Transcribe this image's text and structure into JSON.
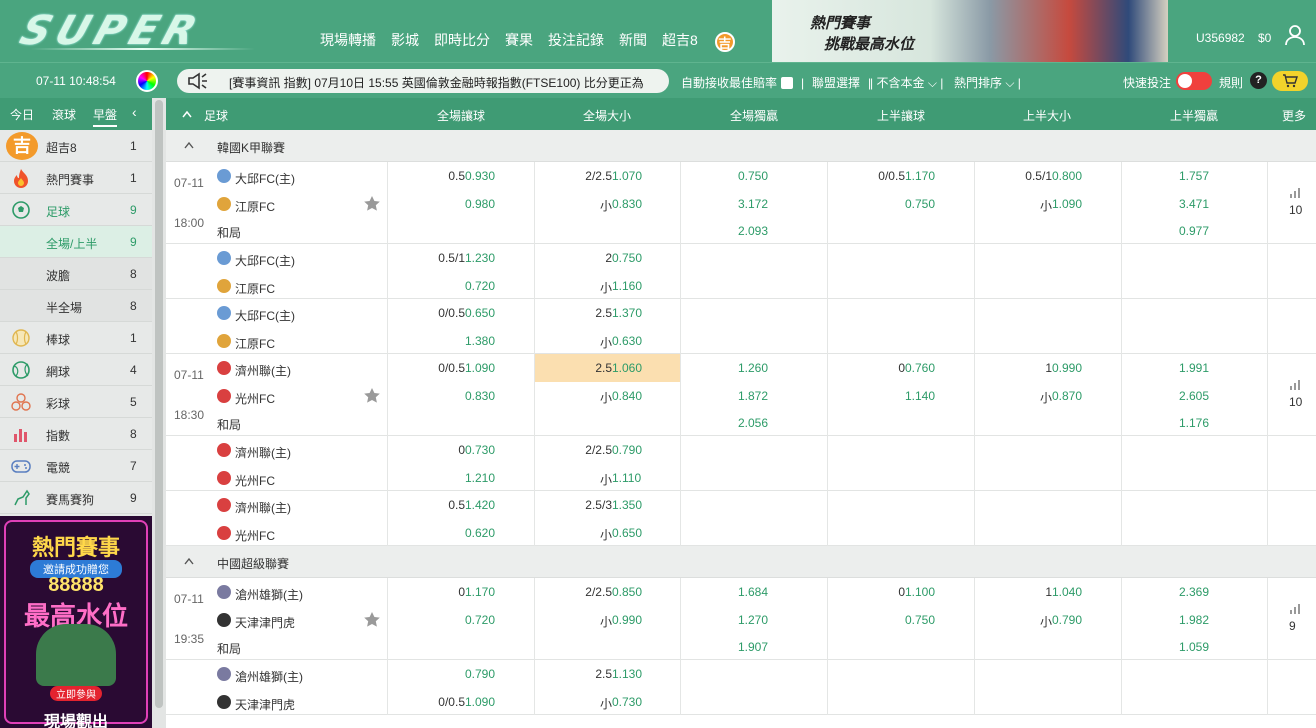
{
  "header": {
    "logo": "SUPER",
    "nav": [
      "現場轉播",
      "影城",
      "即時比分",
      "賽果",
      "投注記錄",
      "新聞",
      "超吉8"
    ],
    "nav_badge": "吉",
    "banner_line1": "熱門賽事",
    "banner_line2": "挑戰最高水位",
    "user_id": "U356982",
    "balance": "$0"
  },
  "infobar": {
    "datetime": "07-11 10:48:54",
    "marquee": "[賽事資訊 指數] 07月10日 15:55 英國倫敦金融時報指數(FTSE100) 比分更正為",
    "auto_accept": "自動接收最佳賠率",
    "league_select": "聯盟選擇",
    "principal": "不含本金",
    "sort": "熱門排序",
    "quick_bet": "快速投注",
    "rules": "規則",
    "help": "?"
  },
  "sidebar": {
    "tabs": [
      "今日",
      "滾球",
      "早盤"
    ],
    "items": [
      {
        "label": "超吉8",
        "count": "1"
      },
      {
        "label": "熱門賽事",
        "count": "1"
      },
      {
        "label": "足球",
        "count": "9"
      },
      {
        "label": "全場/上半",
        "count": "9"
      },
      {
        "label": "波膽",
        "count": "8"
      },
      {
        "label": "半全場",
        "count": "8"
      },
      {
        "label": "棒球",
        "count": "1"
      },
      {
        "label": "網球",
        "count": "4"
      },
      {
        "label": "彩球",
        "count": "5"
      },
      {
        "label": "指數",
        "count": "8"
      },
      {
        "label": "電競",
        "count": "7"
      },
      {
        "label": "賽馬賽狗",
        "count": "9"
      }
    ],
    "promo_title": "熱門賽事",
    "promo_sub": "邀請成功贈您",
    "promo_amount": "88888",
    "promo_line": "最高水位",
    "promo_btn": "立即參與",
    "promo_bottom": "現場觀出"
  },
  "table": {
    "headers": [
      "足球",
      "全場讓球",
      "全場大小",
      "全場獨贏",
      "上半讓球",
      "上半大小",
      "上半獨贏",
      "更多"
    ],
    "leagues": [
      {
        "name": "韓國K甲聯賽"
      },
      {
        "name": "中國超級聯賽"
      }
    ],
    "matches": [
      {
        "date": "07-11",
        "time": "18:00",
        "home": "大邱FC(主)",
        "away": "江原FC",
        "draw": "和局",
        "more": "10",
        "main": {
          "hdp_line": "0.5",
          "hdp_h": "0.930",
          "hdp_a": "0.980",
          "ou_line": "2/2.5",
          "ou_o": "1.070",
          "ou_u_label": "小",
          "ou_u": "0.830",
          "x12_h": "0.750",
          "x12_a": "3.172",
          "x12_d": "2.093",
          "h_hdp_line": "0/0.5",
          "h_hdp_h": "1.170",
          "h_hdp_a": "0.750",
          "h_ou_line": "0.5/1",
          "h_ou_o": "0.800",
          "h_ou_u_label": "小",
          "h_ou_u": "1.090",
          "h_x12_h": "1.757",
          "h_x12_a": "3.471",
          "h_x12_d": "0.977"
        },
        "alts": [
          {
            "hdp_line": "0.5/1",
            "hdp_h": "1.230",
            "hdp_a": "0.720",
            "ou_line": "2",
            "ou_o": "0.750",
            "ou_u_label": "小",
            "ou_u": "1.160"
          },
          {
            "hdp_line": "0/0.5",
            "hdp_h": "0.650",
            "hdp_a": "1.380",
            "ou_line": "2.5",
            "ou_o": "1.370",
            "ou_u_label": "小",
            "ou_u": "0.630"
          }
        ]
      },
      {
        "date": "07-11",
        "time": "18:30",
        "home": "濟州聯(主)",
        "away": "光州FC",
        "draw": "和局",
        "more": "10",
        "main": {
          "hdp_line": "0/0.5",
          "hdp_h": "1.090",
          "hdp_a": "0.830",
          "ou_line": "2.5",
          "ou_o": "1.060",
          "ou_u_label": "小",
          "ou_u": "0.840",
          "x12_h": "1.260",
          "x12_a": "1.872",
          "x12_d": "2.056",
          "h_hdp_line": "0",
          "h_hdp_h": "0.760",
          "h_hdp_a": "1.140",
          "h_ou_line": "1",
          "h_ou_o": "0.990",
          "h_ou_u_label": "小",
          "h_ou_u": "0.870",
          "h_x12_h": "1.991",
          "h_x12_a": "2.605",
          "h_x12_d": "1.176"
        },
        "alts": [
          {
            "hdp_line": "0",
            "hdp_h": "0.730",
            "hdp_a": "1.210",
            "ou_line": "2/2.5",
            "ou_o": "0.790",
            "ou_u_label": "小",
            "ou_u": "1.110"
          },
          {
            "hdp_line": "0.5",
            "hdp_h": "1.420",
            "hdp_a": "0.620",
            "ou_line": "2.5/3",
            "ou_o": "1.350",
            "ou_u_label": "小",
            "ou_u": "0.650"
          }
        ]
      },
      {
        "date": "07-11",
        "time": "19:35",
        "home": "滄州雄獅(主)",
        "away": "天津津門虎",
        "draw": "和局",
        "more": "9",
        "main": {
          "hdp_line": "0",
          "hdp_h": "1.170",
          "hdp_a": "0.720",
          "ou_line": "2/2.5",
          "ou_o": "0.850",
          "ou_u_label": "小",
          "ou_u": "0.990",
          "x12_h": "1.684",
          "x12_a": "1.270",
          "x12_d": "1.907",
          "h_hdp_line": "0",
          "h_hdp_h": "1.100",
          "h_hdp_a": "0.750",
          "h_ou_line": "1",
          "h_ou_o": "1.040",
          "h_ou_u_label": "小",
          "h_ou_u": "0.790",
          "h_x12_h": "2.369",
          "h_x12_a": "1.982",
          "h_x12_d": "1.059"
        },
        "alts": [
          {
            "hdp_line": "",
            "hdp_h": "0.790",
            "hdp_a_line": "0/0.5",
            "hdp_a": "1.090",
            "ou_line": "2.5",
            "ou_o": "1.130",
            "ou_u_label": "小",
            "ou_u": "0.730"
          }
        ]
      }
    ]
  },
  "colors": {
    "brand": "#4aa57f",
    "header_row": "#3f9b74",
    "odds": "#2d9b68",
    "highlight": "#fbdfb0",
    "toggle": "#f0403d",
    "cart": "#f2d32b"
  }
}
